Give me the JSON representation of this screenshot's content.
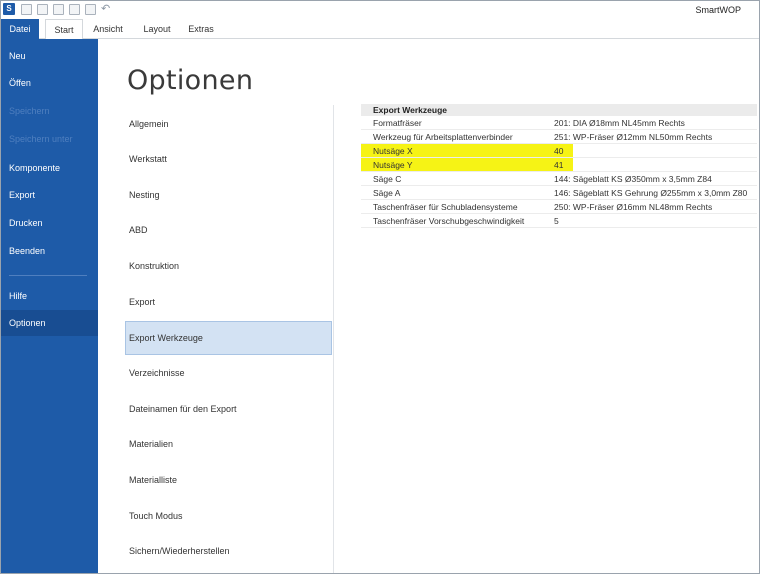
{
  "app": {
    "title": "SmartWOP",
    "icon_letter": "S"
  },
  "quick_access": [
    "save-icon",
    "save-as-icon",
    "new-icon",
    "save-all-icon",
    "print-icon",
    "undo-icon"
  ],
  "tabs": [
    {
      "label": "Datei"
    },
    {
      "label": "Start"
    },
    {
      "label": "Ansicht"
    },
    {
      "label": "Layout"
    },
    {
      "label": "Extras"
    }
  ],
  "nav": {
    "items": [
      {
        "label": "Neu",
        "enabled": true
      },
      {
        "label": "Öffen",
        "enabled": true
      },
      {
        "label": "Speichern",
        "enabled": false
      },
      {
        "label": "Speichern unter",
        "enabled": false
      },
      {
        "label": "Komponente",
        "enabled": true
      },
      {
        "label": "Export",
        "enabled": true
      },
      {
        "label": "Drucken",
        "enabled": true
      },
      {
        "label": "Beenden",
        "enabled": true
      },
      {
        "label": "Hilfe",
        "enabled": true
      },
      {
        "label": "Optionen",
        "enabled": true,
        "selected": true
      }
    ]
  },
  "page": {
    "title": "Optionen"
  },
  "categories": [
    "Allgemein",
    "Werkstatt",
    "Nesting",
    "ABD",
    "Konstruktion",
    "Export",
    "Export Werkzeuge",
    "Verzeichnisse",
    "Dateinamen für den Export",
    "Materialien",
    "Materialliste",
    "Touch Modus",
    "Sichern/Wiederherstellen"
  ],
  "selected_category": "Export Werkzeuge",
  "grid": {
    "header": "Export Werkzeuge",
    "rows": [
      {
        "key": "Formatfräser",
        "value": "201: DIA Ø18mm NL45mm Rechts"
      },
      {
        "key": "Werkzeug für Arbeitsplattenverbinder",
        "value": "251: WP-Fräser Ø12mm NL50mm Rechts"
      },
      {
        "key": "Nutsäge X",
        "value": "40",
        "highlight": true
      },
      {
        "key": "Nutsäge Y",
        "value": "41",
        "highlight": true
      },
      {
        "key": "Säge C",
        "value": "144: Sägeblatt KS Ø350mm x 3,5mm Z84"
      },
      {
        "key": "Säge A",
        "value": "146: Sägeblatt KS Gehrung Ø255mm x 3,0mm Z80"
      },
      {
        "key": "Taschenfräser für Schubladensysteme",
        "value": "250: WP-Fräser Ø16mm NL48mm Rechts"
      },
      {
        "key": "Taschenfräser Vorschubgeschwindigkeit",
        "value": "5"
      }
    ]
  },
  "colors": {
    "accent": "#1e5ba8",
    "highlight": "#f6f315",
    "selection": "#d3e2f3"
  }
}
